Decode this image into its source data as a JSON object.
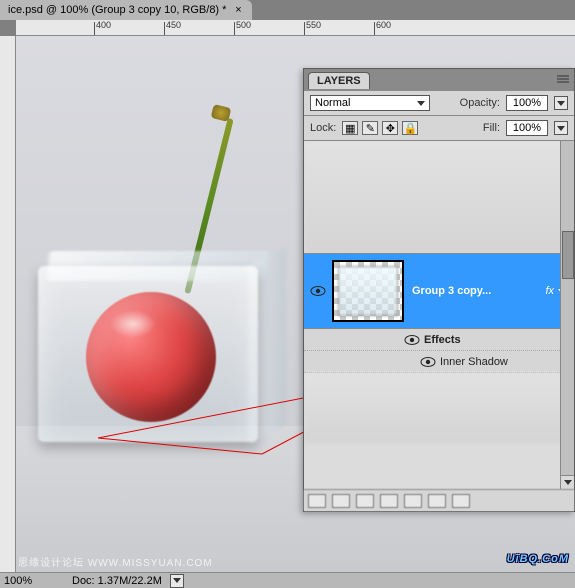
{
  "document_tab": {
    "title": "ice.psd @ 100% (Group 3 copy 10, RGB/8) *"
  },
  "ruler_marks": [
    "400",
    "450",
    "500",
    "550",
    "600"
  ],
  "status": {
    "zoom": "100%",
    "doc_size": "Doc: 1.37M/22.2M"
  },
  "watermark": {
    "left": "思缘设计论坛  WWW.MISSYUAN.COM",
    "right": "UiBQ.CoM"
  },
  "layers_panel": {
    "tab": "LAYERS",
    "blend_mode": "Normal",
    "opacity_label": "Opacity:",
    "opacity_value": "100%",
    "lock_label": "Lock:",
    "fill_label": "Fill:",
    "fill_value": "100%",
    "selected_layer": {
      "name": "Group 3 copy...",
      "fx": "fx"
    },
    "effects": {
      "title": "Effects",
      "items": [
        "Inner Shadow"
      ]
    }
  }
}
